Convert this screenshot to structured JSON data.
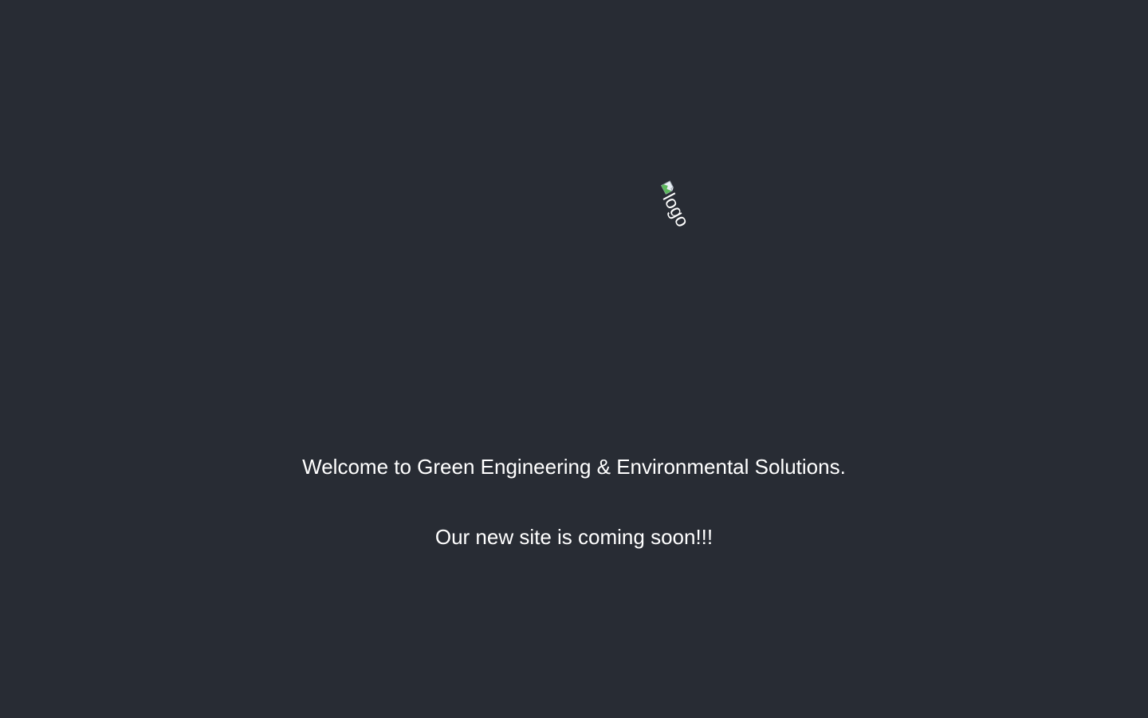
{
  "logo": {
    "alt": "logo",
    "icon": "broken-image-icon"
  },
  "welcome_text": "Welcome to Green Engineering & Environmental Solutions.",
  "coming_soon_text": "Our new site is coming soon!!!",
  "colors": {
    "background": "#282c34",
    "text": "#ffffff"
  }
}
